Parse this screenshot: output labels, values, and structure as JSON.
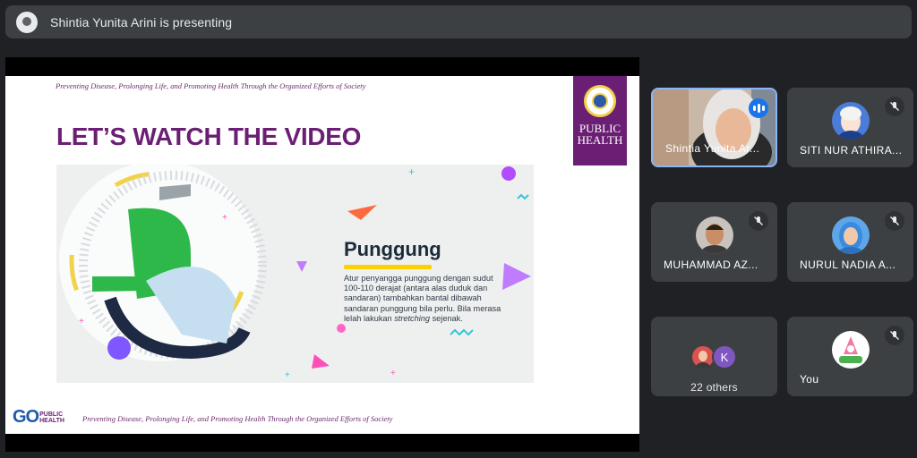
{
  "presentation_bar": {
    "presenting_text": "Shintia Yunita Arini is presenting"
  },
  "slide": {
    "tagline_top": "Preventing Disease, Prolonging Life, and Promoting Health Through the Organized Efforts of Society",
    "title": "LET’S WATCH THE VIDEO",
    "logo_text_line1": "PUBLIC",
    "logo_text_line2": "HEALTH",
    "video": {
      "heading": "Punggung",
      "body_before": "Atur penyangga punggung dengan sudut 100-110 derajat (antara alas duduk dan sandaran) tambahkan bantal dibawah sandaran punggung bila perlu. Bila merasa lelah lakukan ",
      "body_italic": "stretching",
      "body_after": " sejenak."
    },
    "footer_logo_go": "GO",
    "footer_logo_sub1": "PUBLIC",
    "footer_logo_sub2": "HEALTH",
    "tagline_bottom": "Preventing Disease, Prolonging Life, and Promoting Health Through the Organized Efforts of Society"
  },
  "participants": [
    {
      "name": "Shintia Yunita Ar...",
      "state": "speaking"
    },
    {
      "name": "SITI NUR ATHIRA...",
      "state": "muted"
    },
    {
      "name": "MUHAMMAD AZ...",
      "state": "muted"
    },
    {
      "name": "NURUL NADIA A...",
      "state": "muted"
    },
    {
      "name": "You",
      "state": "muted"
    }
  ],
  "others": {
    "label": "22 others",
    "initial": "K"
  },
  "colors": {
    "background": "#202124",
    "tile": "#3c4043",
    "slide_purple": "#6b1f74",
    "active_border": "#8ab4f8",
    "speaking_blue": "#1a73e8"
  }
}
